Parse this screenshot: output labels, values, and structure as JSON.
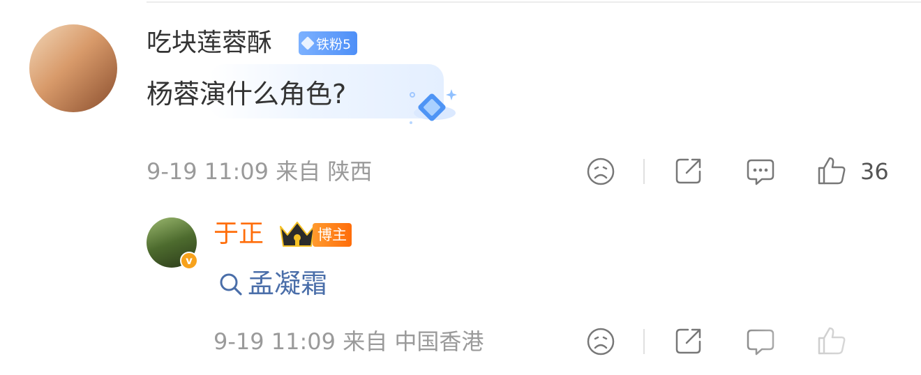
{
  "comment": {
    "username": "吃块莲蓉酥",
    "badge": "铁粉5",
    "text": "杨蓉演什么角色?",
    "time": "9-19 11:09",
    "source": "来自 陕西",
    "likes": "36"
  },
  "reply": {
    "username": "于正",
    "badge": "博主",
    "verified_mark": "v",
    "text": "孟凝霜",
    "time": "9-19 11:09",
    "source": "来自 中国香港"
  },
  "colors": {
    "link": "#4a6ea9",
    "username_vip": "#ff6d0a",
    "meta": "#9a9a9a",
    "fan_badge": "#5b9af8",
    "blogger_badge": "#ff7a1a"
  }
}
